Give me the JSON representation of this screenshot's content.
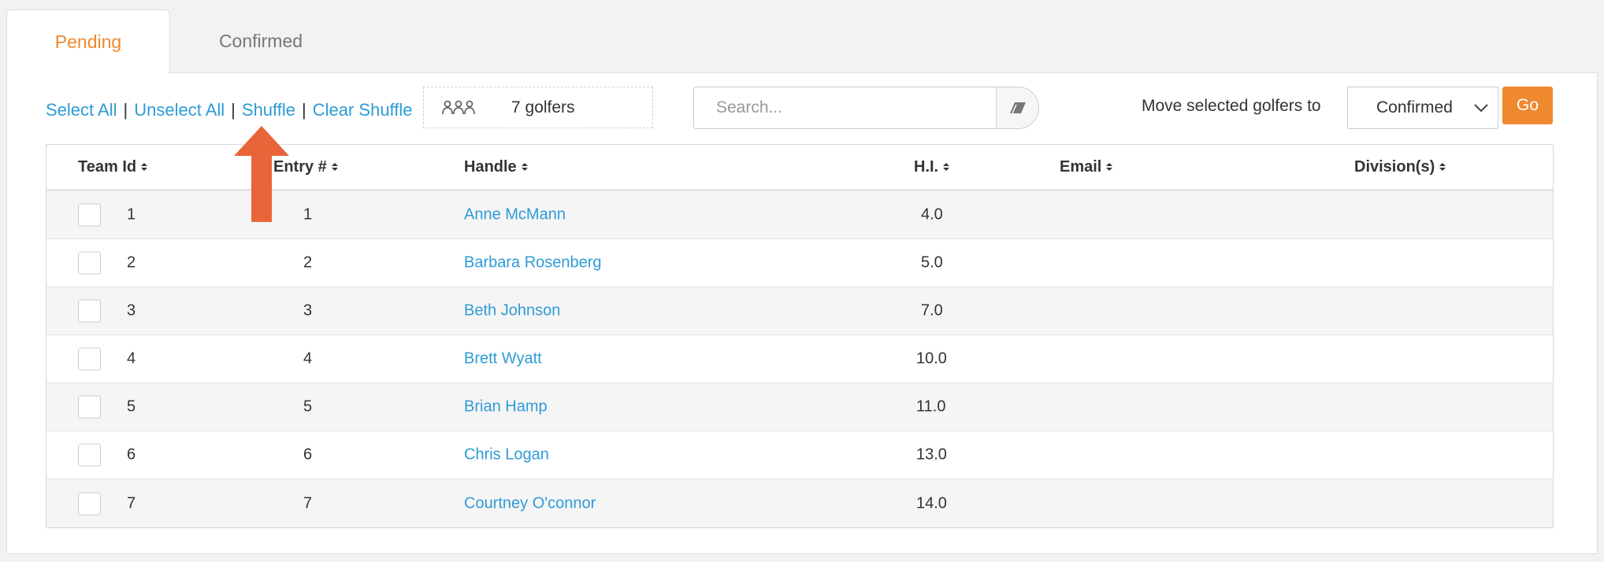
{
  "tabs": [
    {
      "label": "Pending",
      "active": true
    },
    {
      "label": "Confirmed",
      "active": false
    }
  ],
  "toolbar": {
    "select_all": "Select All",
    "unselect_all": "Unselect All",
    "shuffle": "Shuffle",
    "clear_shuffle": "Clear Shuffle",
    "separator": "|",
    "golfer_count": "7 golfers",
    "search_placeholder": "Search...",
    "move_label": "Move selected golfers to",
    "move_target": "Confirmed",
    "go_label": "Go"
  },
  "table": {
    "columns": [
      "Team Id",
      "Entry #",
      "Handle",
      "H.I.",
      "Email",
      "Division(s)"
    ],
    "rows": [
      {
        "team_id": "1",
        "entry": "1",
        "handle": "Anne McMann",
        "hi": "4.0",
        "email": "",
        "division": ""
      },
      {
        "team_id": "2",
        "entry": "2",
        "handle": "Barbara Rosenberg",
        "hi": "5.0",
        "email": "",
        "division": ""
      },
      {
        "team_id": "3",
        "entry": "3",
        "handle": "Beth Johnson",
        "hi": "7.0",
        "email": "",
        "division": ""
      },
      {
        "team_id": "4",
        "entry": "4",
        "handle": "Brett Wyatt",
        "hi": "10.0",
        "email": "",
        "division": ""
      },
      {
        "team_id": "5",
        "entry": "5",
        "handle": "Brian Hamp",
        "hi": "11.0",
        "email": "",
        "division": ""
      },
      {
        "team_id": "6",
        "entry": "6",
        "handle": "Chris Logan",
        "hi": "13.0",
        "email": "",
        "division": ""
      },
      {
        "team_id": "7",
        "entry": "7",
        "handle": "Courtney O'connor",
        "hi": "14.0",
        "email": "",
        "division": ""
      }
    ]
  },
  "colors": {
    "accent": "#f0882f",
    "link": "#2e9bd6",
    "annotation_arrow": "#e8653a"
  },
  "icons": {
    "golfers": "group-icon",
    "clear": "eraser-icon",
    "dropdown": "chevron-down-icon",
    "annotation": "arrow-up-icon"
  }
}
